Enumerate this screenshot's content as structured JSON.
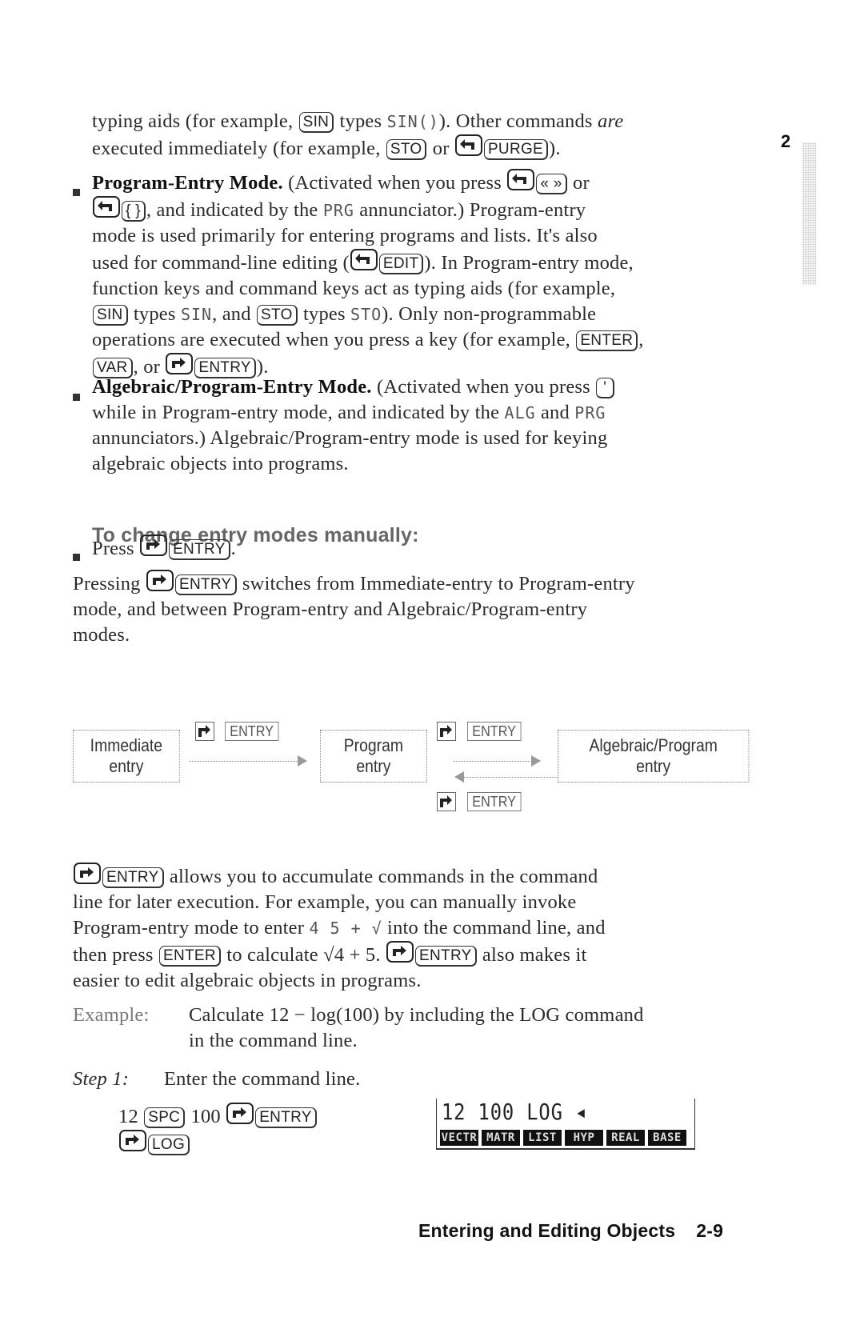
{
  "page": {
    "chapter_tab_number": "2",
    "footer": {
      "title": "Entering and Editing Objects",
      "page_number": "2-9"
    }
  },
  "intro": {
    "line1": {
      "a": "typing aids (for example, ",
      "key1": "SIN",
      "b": " types ",
      "lcd1": "SIN()",
      "c": "). Other commands ",
      "em": "are"
    },
    "line2": {
      "a": "executed immediately (for example, ",
      "key1": "STO",
      "b": " or ",
      "key2": "PURGE",
      "c": ")."
    }
  },
  "modes": [
    {
      "title": "Program-Entry Mode.",
      "lines": {
        "l1a": " (Activated when you press ",
        "l1key": "« »",
        "l1b": " or",
        "l2key": "{ }",
        "l2a": ", and indicated by the ",
        "l2lcd": "PRG",
        "l2b": " annunciator.) Program-entry",
        "l3": "mode is used primarily for entering programs and lists. It's also",
        "l4a": "used for command-line editing (",
        "l4key": "EDIT",
        "l4b": "). In Program-entry mode,",
        "l5": "function keys and command keys act as typing aids (for example,",
        "l6key1": "SIN",
        "l6a": " types ",
        "l6lcd1": "SIN",
        "l6b": ", and ",
        "l6key2": "STO",
        "l6c": " types ",
        "l6lcd2": "STO",
        "l6d": "). Only non-programmable",
        "l7a": "operations are executed when you press a key (for example, ",
        "l7key": "ENTER",
        "l7b": ",",
        "l8key1": "VAR",
        "l8a": ", or ",
        "l8key2": "ENTRY",
        "l8b": ")."
      }
    },
    {
      "title": "Algebraic/Program-Entry Mode.",
      "lines": {
        "l1a": " (Activated when you press ",
        "l1key": "'",
        "l2a": "while in Program-entry mode, and indicated by the ",
        "l2lcd1": "ALG",
        "l2b": " and ",
        "l2lcd2": "PRG",
        "l3": "annunciators.) Algebraic/Program-entry mode is used for keying",
        "l4": "algebraic objects into programs."
      }
    }
  ],
  "procedure": {
    "heading": "To change entry modes manually:",
    "step_press": "Press ",
    "step_key": "ENTRY",
    "step_end": ".",
    "explain": {
      "l1a": "Pressing ",
      "l1key": "ENTRY",
      "l1b": " switches from Immediate-entry to Program-entry",
      "l2": "mode, and between Program-entry and Algebraic/Program-entry",
      "l3": "modes."
    }
  },
  "diagram": {
    "boxes": [
      {
        "line1": "Immediate",
        "line2": "entry"
      },
      {
        "line1": "Program",
        "line2": "entry"
      },
      {
        "line1": "Algebraic/Program",
        "line2": "entry"
      }
    ],
    "transition_key": "ENTRY"
  },
  "accumulate": {
    "l1key": "ENTRY",
    "l1a": " allows you to accumulate commands in the command",
    "l2": "line for later execution. For example, you can manually invoke",
    "l3a": "Program-entry mode to enter ",
    "l3lcd": "4 5 + √",
    "l3b": " into the command line, and",
    "l4a": "then press ",
    "l4key": "ENTER",
    "l4b": " to calculate ",
    "l4math": "√4 + 5",
    "l4c": ". ",
    "l4key2": "ENTRY",
    "l4d": " also makes it",
    "l5": "easier to edit algebraic objects in programs."
  },
  "example": {
    "label": "Example:",
    "l1": "Calculate 12 − log(100) by including the LOG command",
    "l2": "in the command line.",
    "step_label": "Step 1:",
    "step_text": "Enter the command line.",
    "keys_l1": {
      "n1": "12 ",
      "k1": "SPC",
      "n2": " 100 ",
      "k2": "ENTRY"
    },
    "keys_l2": {
      "k1": "LOG"
    },
    "screen": {
      "command_line": "12 100 LOG ◂",
      "menu": [
        "VECTR",
        "MATR",
        "LIST",
        "HYP",
        "REAL",
        "BASE"
      ]
    }
  }
}
